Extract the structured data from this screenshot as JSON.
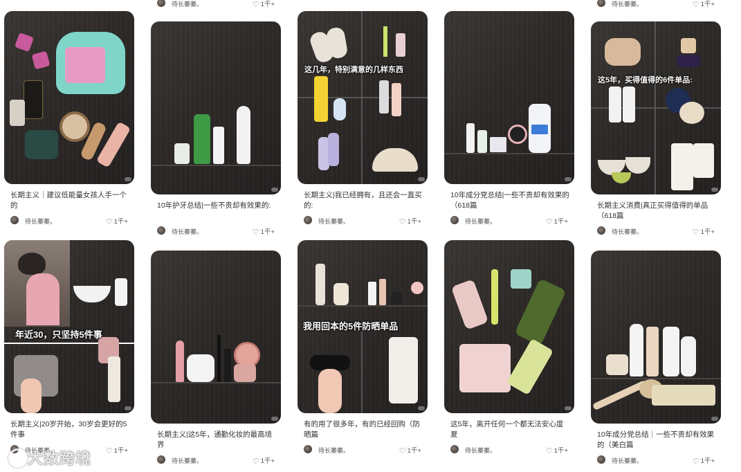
{
  "author_name": "待长蓁蓁。",
  "like_count": "1千+",
  "watermark": "大数跨境",
  "icons": {
    "like": "heart-icon",
    "avatar": "avatar"
  },
  "columns": [
    {
      "cards": [
        {
          "title": "长期主义｜建议低能量女孩人手一个的",
          "overlay": ""
        },
        {
          "title": "长期主义|20岁开始，30岁会更好的5件事",
          "overlay": "年近30，只坚持5件事"
        }
      ]
    },
    {
      "cards": [
        {
          "title": "10年护牙总结|一些不贵却有效果的:",
          "overlay": ""
        },
        {
          "title": "长期主义|这5年，通勤化妆的最高境界",
          "overlay": ""
        }
      ]
    },
    {
      "cards": [
        {
          "title": "长期主义|我已经拥有，且还会一直买的:",
          "overlay": "这几年，特别满意的几样东西"
        },
        {
          "title": "有的用了很多年，有的已经回购（防晒篇",
          "overlay": "我用回本的5件防晒单品"
        }
      ]
    },
    {
      "cards": [
        {
          "title": "10年成分党总结|一些不贵却有效果的（618篇",
          "overlay": ""
        },
        {
          "title": "这5年，离开任何一个都无法安心度夏",
          "overlay": ""
        }
      ]
    },
    {
      "cards": [
        {
          "title": "长期主义消费|真正买得值得的单品（618篇",
          "overlay": "这5年，买得值得的6件单品:"
        },
        {
          "title": "10年成分党总结｜一些不贵却有效果的（美白篇",
          "overlay": ""
        }
      ]
    }
  ]
}
